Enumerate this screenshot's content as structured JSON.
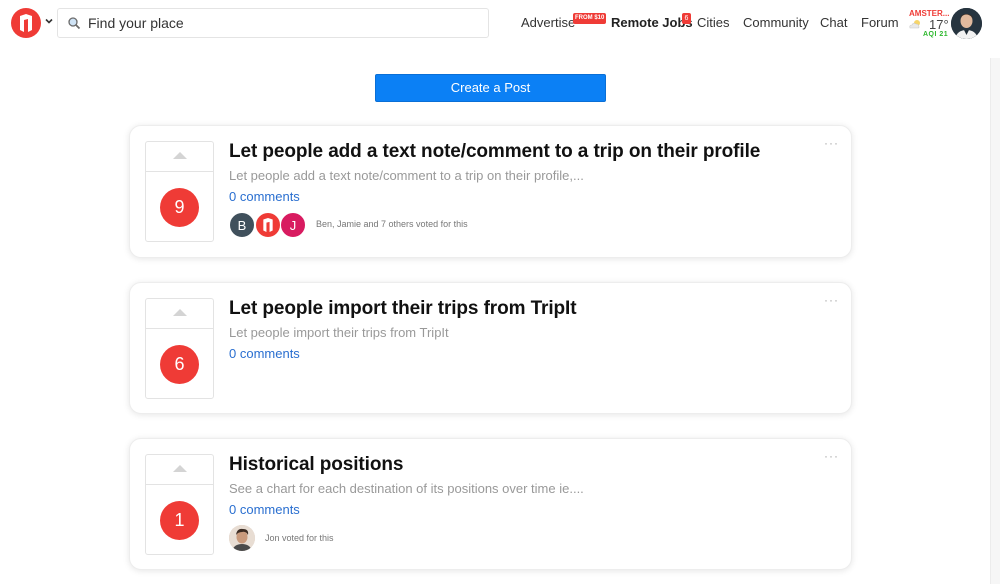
{
  "header": {
    "search_placeholder": "Find your place",
    "nav": {
      "advertise": "Advertise",
      "advertise_badge": "FROM $10",
      "remote_jobs": "Remote Jobs",
      "remote_jobs_badge": "6",
      "cities": "Cities",
      "community": "Community",
      "chat": "Chat",
      "forum": "Forum"
    },
    "weather": {
      "city": "AMSTER...",
      "temp": "17°",
      "aqi": "AQI 21",
      "icon": "cloud-sun-icon"
    }
  },
  "create_post_label": "Create a Post",
  "more_label": "···",
  "posts": [
    {
      "votes": "9",
      "title": "Let people add a text note/comment to a trip on their profile",
      "excerpt": "Let people add a text note/comment to a trip on their profile,...",
      "comments": "0 comments",
      "voter_initials": [
        "B",
        "",
        "J"
      ],
      "voters_text": "Ben, Jamie and 7 others voted for this"
    },
    {
      "votes": "6",
      "title": "Let people import their trips from TripIt",
      "excerpt": "Let people import their trips from TripIt",
      "comments": "0 comments"
    },
    {
      "votes": "1",
      "title": "Historical positions",
      "excerpt": "See a chart for each destination of its positions over time ie....",
      "comments": "0 comments",
      "voters_text": "Jon voted for this"
    }
  ],
  "colors": {
    "brand": "#ef3b36",
    "primary_button": "#0b80f5",
    "link": "#2a6fd0",
    "aqi": "#2eb82e"
  }
}
